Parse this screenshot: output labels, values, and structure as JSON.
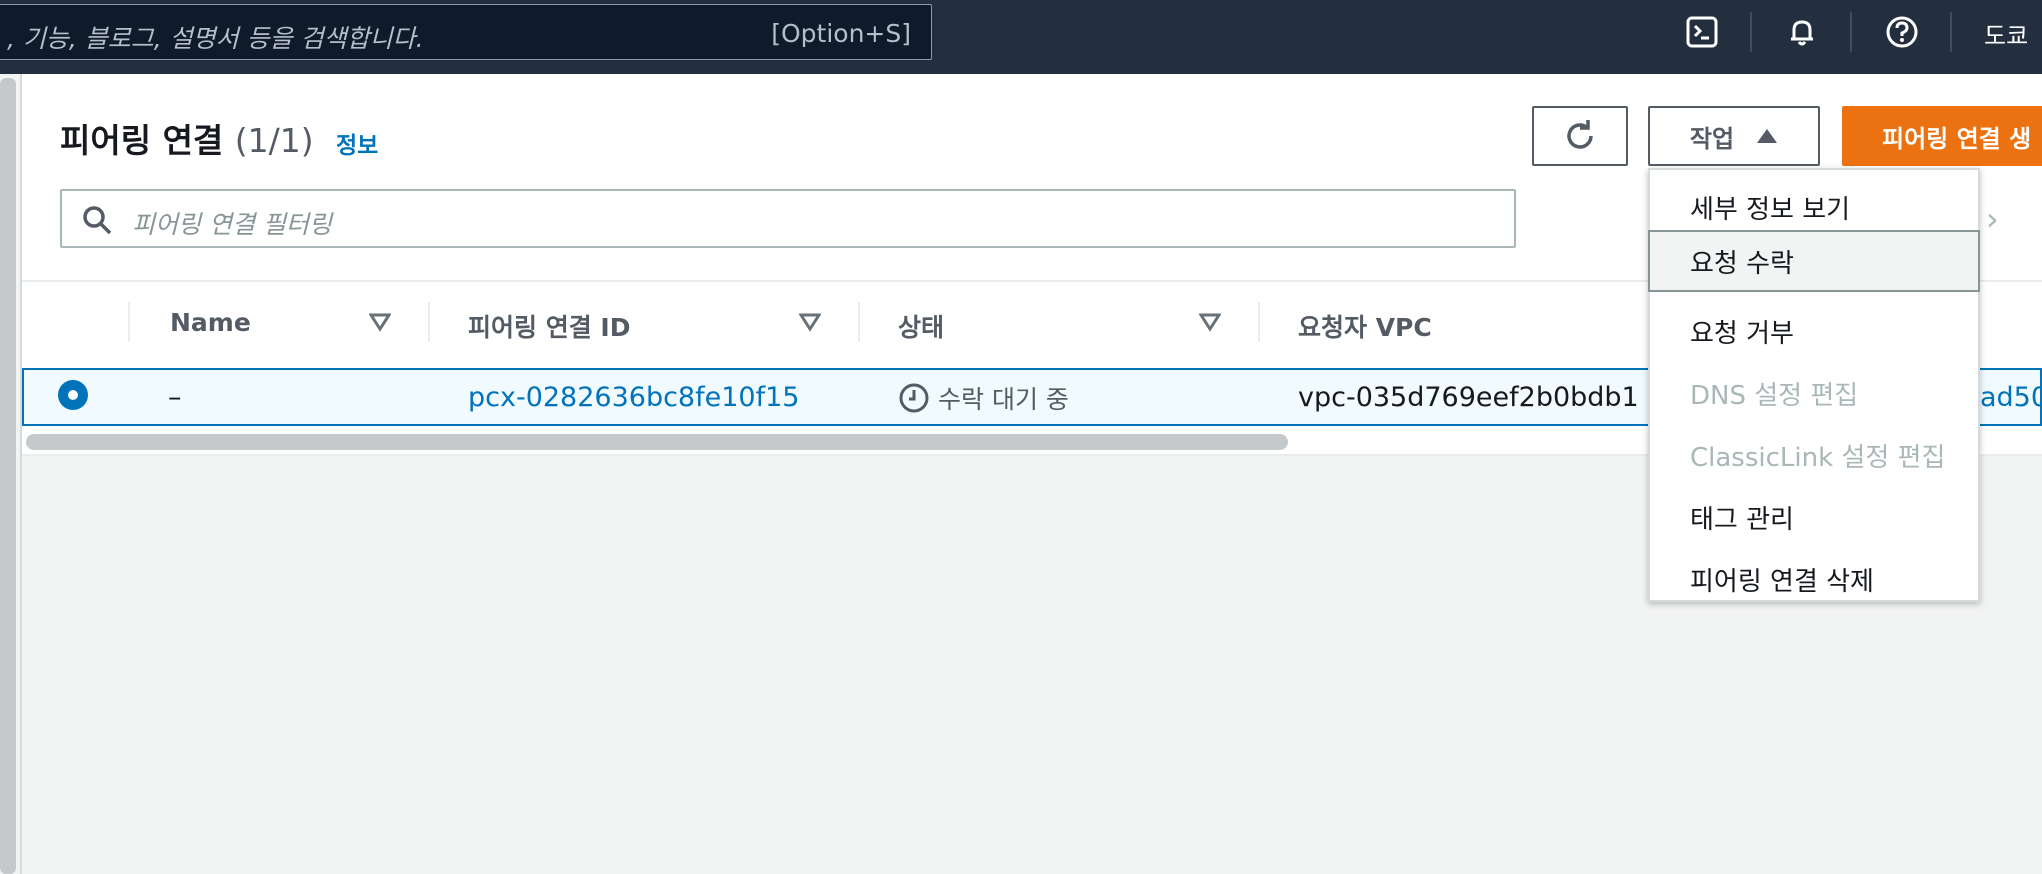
{
  "topbar": {
    "search_placeholder": ", 기능, 블로그, 설명서 등을 검색합니다.",
    "search_shortcut": "[Option+S]",
    "region": "도쿄",
    "icons": [
      "cloudshell-icon",
      "bell-icon",
      "help-icon"
    ]
  },
  "header": {
    "title": "피어링 연결",
    "count": "(1/1)",
    "info": "정보"
  },
  "toolbar": {
    "refresh_icon": "refresh-icon",
    "actions_label": "작업",
    "create_label": "피어링 연결 생"
  },
  "filter": {
    "placeholder": "피어링 연결 필터링"
  },
  "table": {
    "columns": [
      "Name",
      "피어링 연결 ID",
      "상태",
      "요청자 VPC"
    ],
    "rows": [
      {
        "name": "–",
        "id": "pcx-0282636bc8fe10f15",
        "status": "수락 대기 중",
        "requester_vpc": "vpc-035d769eef2b0bdb1",
        "accepter_vpc_partial": "ad50"
      }
    ]
  },
  "actions_menu": {
    "items": [
      {
        "label": "세부 정보 보기",
        "enabled": true
      },
      {
        "label": "요청 수락",
        "enabled": true
      },
      {
        "label": "요청 거부",
        "enabled": true
      },
      {
        "label": "DNS 설정 편집",
        "enabled": false
      },
      {
        "label": "ClassicLink 설정 편집",
        "enabled": false
      },
      {
        "label": "태그 관리",
        "enabled": true
      },
      {
        "label": "피어링 연결 삭제",
        "enabled": true
      }
    ]
  },
  "colors": {
    "link": "#0073bb",
    "primary": "#ec7211",
    "topbar": "#232f3e"
  }
}
